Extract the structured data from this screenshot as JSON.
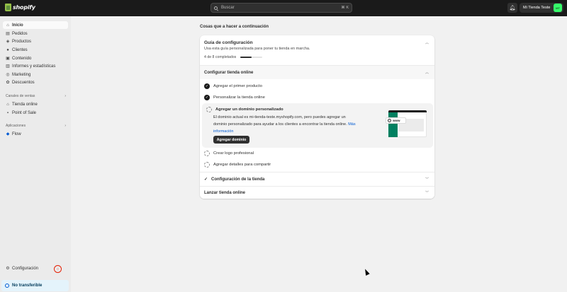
{
  "topbar": {
    "logo_text": "shopify",
    "search_placeholder": "Buscar",
    "search_shortcut": "⌘ K",
    "store_name": "Mi Tienda Teste",
    "avatar_initials": "MT"
  },
  "sidebar": {
    "items": [
      {
        "label": "Inicio",
        "icon": "home-icon"
      },
      {
        "label": "Pedidos",
        "icon": "inbox-icon"
      },
      {
        "label": "Productos",
        "icon": "tag-icon"
      },
      {
        "label": "Clientes",
        "icon": "person-icon"
      },
      {
        "label": "Contenido",
        "icon": "image-icon"
      },
      {
        "label": "Informes y estadísticas",
        "icon": "chart-icon"
      },
      {
        "label": "Marketing",
        "icon": "target-icon"
      },
      {
        "label": "Descuentos",
        "icon": "discount-icon"
      }
    ],
    "sales_channels_label": "Canales de ventas",
    "sales_channels": [
      {
        "label": "Tienda online",
        "icon": "store-icon"
      },
      {
        "label": "Point of Sale",
        "icon": "pos-icon"
      }
    ],
    "apps_label": "Aplicaciones",
    "apps": [
      {
        "label": "Flow",
        "icon": "flow-icon"
      }
    ],
    "settings_label": "Configuración",
    "banner_label": "No transferible"
  },
  "main": {
    "page_title": "Cosas que a hacer a continuación",
    "guide": {
      "title": "Guía de configuración",
      "subtitle": "Usa esta guía personalizada para poner tu tienda en marcha.",
      "progress_text": "4 de 8 completados",
      "progress": 0.5,
      "section_title": "Configurar tienda online",
      "tasks": [
        {
          "label": "Agregar el primer producto",
          "done": true
        },
        {
          "label": "Personalizar la tienda online",
          "done": true
        }
      ],
      "expanded_task": {
        "title": "Agregar un dominio personalizado",
        "description": "El dominio actual es mi-tienda-teste.myshopify.com, pero puedes agregar un dominio personalizado para ayudar a los clientes a encontrar la tienda online.",
        "link": "Más información",
        "button": "Agregar dominio",
        "illustration_text": "www"
      },
      "remaining_tasks": [
        {
          "label": "Crear logo profesional",
          "done": false
        },
        {
          "label": "Agregar detalles para compartir",
          "done": false
        }
      ],
      "collapsed_sections": [
        {
          "label": "Configuración de la tienda",
          "done": true
        },
        {
          "label": "Lanzar tienda online",
          "done": false
        }
      ]
    }
  },
  "colors": {
    "topbar": "#1a1a1a",
    "sidebar": "#ebebeb",
    "accent_blue": "#005bd3",
    "avatar_green": "#36fc6a",
    "brand_green": "#95bf47"
  }
}
